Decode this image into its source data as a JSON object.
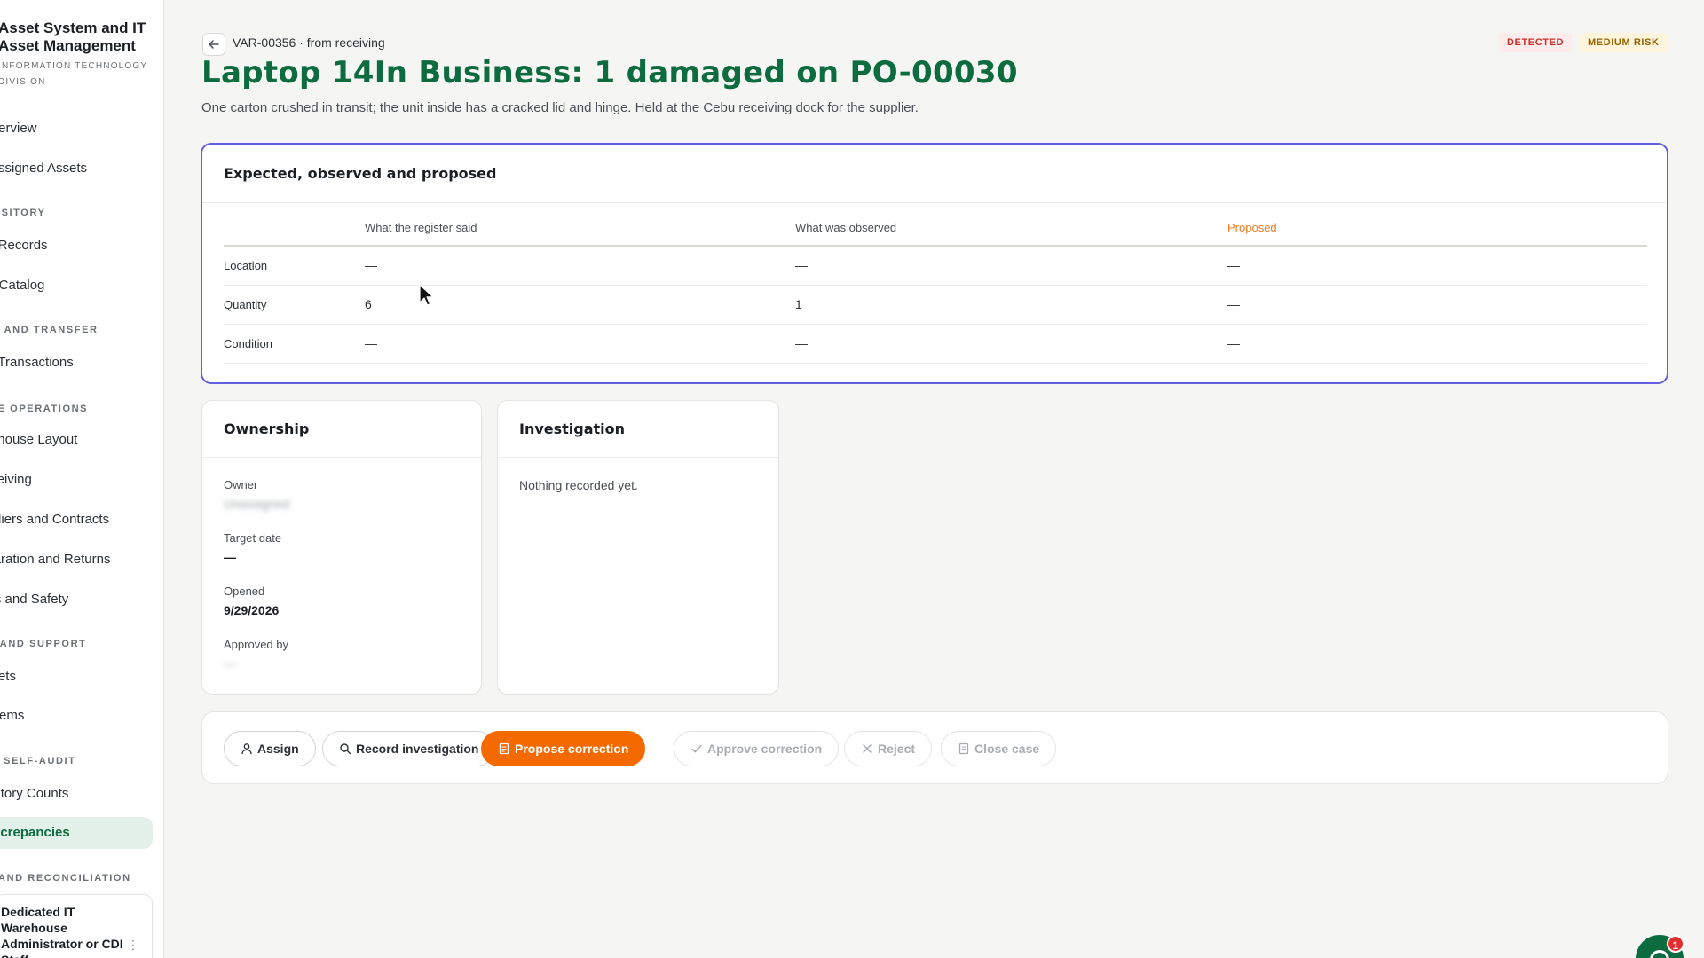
{
  "app": {
    "title": "Asset System and IT\nAsset Management",
    "subtitle": "Information Technology\nDivision"
  },
  "sidebar": {
    "items": [
      {
        "type": "item",
        "label": "Overview"
      },
      {
        "type": "item",
        "label": "Assigned Assets"
      },
      {
        "type": "section",
        "label": "Repository"
      },
      {
        "type": "item",
        "label": "Asset Records"
      },
      {
        "type": "item",
        "label": "Asset Catalog"
      },
      {
        "type": "section",
        "label": "Movement and Transfer"
      },
      {
        "type": "item",
        "label": "Asset Transactions"
      },
      {
        "type": "section",
        "label": "Warehouse Operations"
      },
      {
        "type": "item",
        "label": "Warehouse Layout"
      },
      {
        "type": "item",
        "label": "Receiving"
      },
      {
        "type": "item",
        "label": "Suppliers and Contracts"
      },
      {
        "type": "item",
        "label": "Separation and Returns"
      },
      {
        "type": "item",
        "label": "Access and Safety"
      },
      {
        "type": "section",
        "label": "Help and Support"
      },
      {
        "type": "item",
        "label": "Tickets"
      },
      {
        "type": "item",
        "label": "Problems"
      },
      {
        "type": "section",
        "label": "Audit and Self-Audit"
      },
      {
        "type": "item",
        "label": "Inventory Counts"
      },
      {
        "type": "item",
        "label": "Discrepancies",
        "active": true
      },
      {
        "type": "section",
        "label": "Reporting and Reconciliation"
      }
    ],
    "user": {
      "name": "Dedicated IT\nWarehouse\nAdministrator or CDI\nStaff",
      "menu": "⋮"
    }
  },
  "header": {
    "breadcrumb": "VAR-00356 · from receiving",
    "badges": [
      "DETECTED",
      "MEDIUM RISK"
    ],
    "title": "Laptop 14In Business: 1 damaged on PO-00030",
    "description": "One carton crushed in transit; the unit inside has a cracked lid and hinge. Held at the Cebu receiving dock for the supplier."
  },
  "comparison": {
    "title": "Expected, observed and proposed",
    "columns": [
      "",
      "What the register said",
      "What was observed",
      "Proposed"
    ],
    "rows": [
      {
        "label": "Location",
        "expected": "—",
        "observed": "—",
        "proposed": "—"
      },
      {
        "label": "Quantity",
        "expected": "6",
        "observed": "1",
        "proposed": "—"
      },
      {
        "label": "Condition",
        "expected": "—",
        "observed": "—",
        "proposed": "—"
      }
    ]
  },
  "ownership": {
    "title": "Ownership",
    "owner_label": "Owner",
    "owner_value": "Unassigned",
    "target_label": "Target date",
    "target_value": "—",
    "opened_label": "Opened",
    "opened_value": "9/29/2026",
    "approved_label": "Approved by",
    "approved_value": "—"
  },
  "investigation": {
    "title": "Investigation",
    "empty": "Nothing recorded yet."
  },
  "actions": {
    "assign": "Assign",
    "record": "Record investigation",
    "propose": "Propose correction",
    "approve": "Approve correction",
    "reject": "Reject",
    "close": "Close case"
  },
  "notifications": {
    "count": "1"
  },
  "colors": {
    "brand": "#0c6b3f",
    "accent": "#f56a00",
    "focus": "#6260e0",
    "detected": "#c9302c",
    "risk": "#9a6200"
  }
}
